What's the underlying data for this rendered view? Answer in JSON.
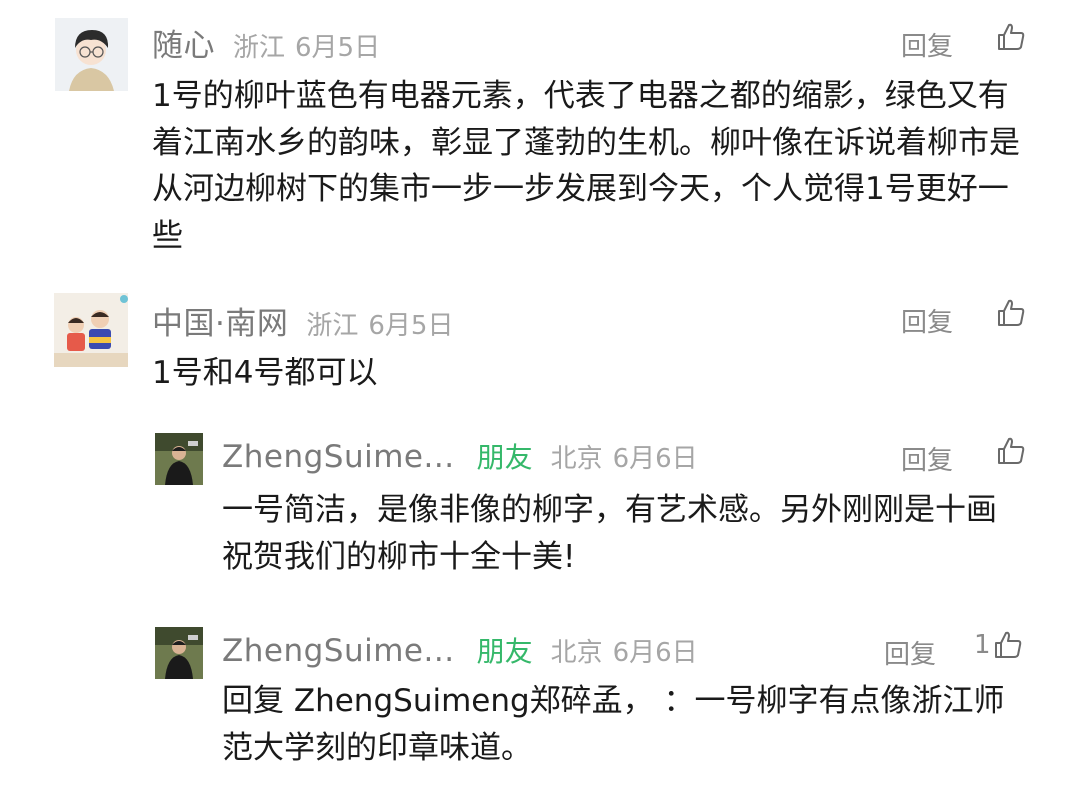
{
  "comments": [
    {
      "nickname": "随心",
      "location": "浙江",
      "date": "6月5日",
      "reply_label": "回复",
      "text": "1号的柳叶蓝色有电器元素，代表了电器之都的缩影，绿色又有着江南水乡的韵味，彰显了蓬勃的生机。柳叶像在诉说着柳市是从河边柳树下的集市一步一步发展到今天，个人觉得1号更好一些"
    },
    {
      "nickname": "中国·南网",
      "location": "浙江",
      "date": "6月5日",
      "reply_label": "回复",
      "text": "1号和4号都可以"
    }
  ],
  "replies": [
    {
      "nickname": "ZhengSuime...",
      "friend_badge": "朋友",
      "location": "北京",
      "date": "6月6日",
      "reply_label": "回复",
      "text": "一号简洁，是像非像的柳字，有艺术感。另外刚刚是十画祝贺我们的柳市十全十美!"
    },
    {
      "nickname": "ZhengSuime...",
      "friend_badge": "朋友",
      "location": "北京",
      "date": "6月6日",
      "reply_label": "回复",
      "like_count": "1",
      "text": "回复 ZhengSuimeng郑碎孟， ：一号柳字有点像浙江师范大学刻的印章味道。"
    }
  ],
  "icons": {
    "like": "thumbs-up-icon"
  },
  "colors": {
    "friend_badge": "#35b86a",
    "nickname": "#7a7a7a",
    "meta": "#a6a6a6"
  }
}
